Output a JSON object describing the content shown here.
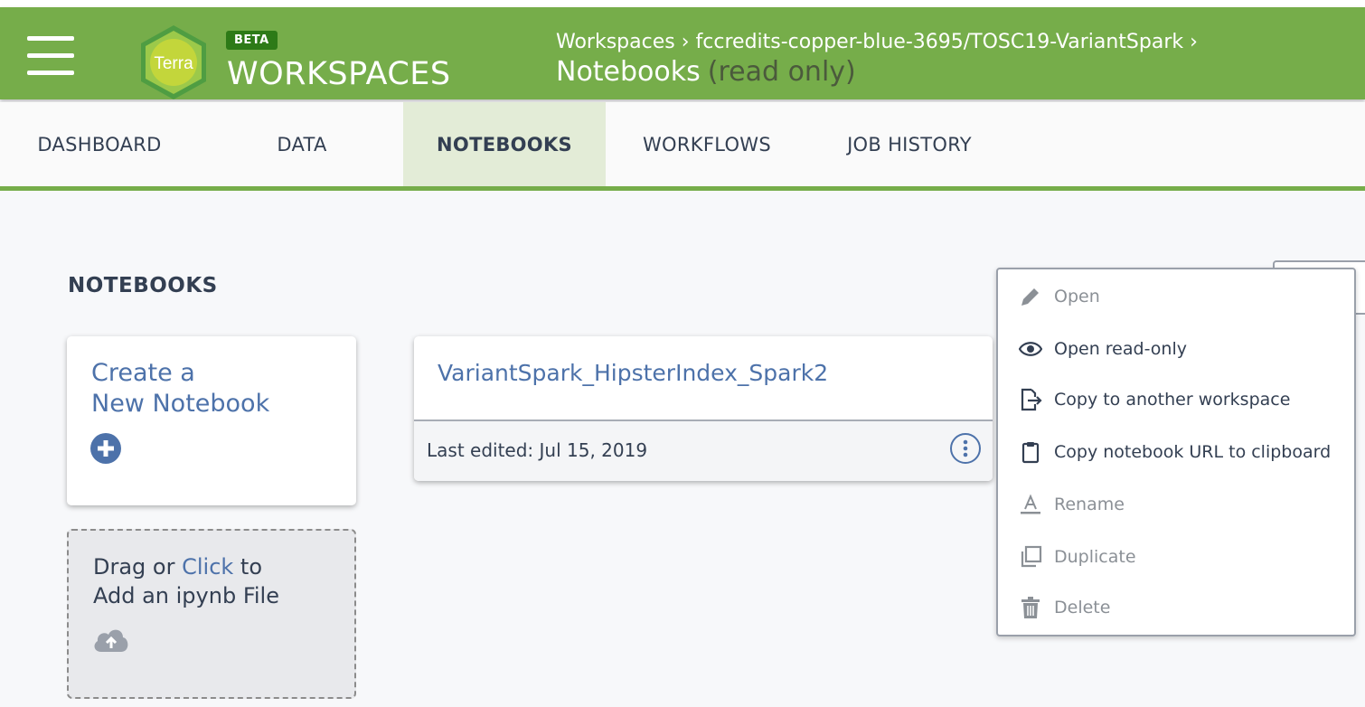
{
  "header": {
    "logo_text": "Terra",
    "badge": "BETA",
    "product": "WORKSPACES",
    "breadcrumb_root": "Workspaces",
    "breadcrumb_separator": "›",
    "breadcrumb_workspace": "fccredits-copper-blue-3695/TOSC19-VariantSpark",
    "title": "Notebooks",
    "title_suffix": "(read only)"
  },
  "tabs": [
    {
      "label": "DASHBOARD",
      "active": false
    },
    {
      "label": "DATA",
      "active": false
    },
    {
      "label": "NOTEBOOKS",
      "active": true
    },
    {
      "label": "WORKFLOWS",
      "active": false
    },
    {
      "label": "JOB HISTORY",
      "active": false
    }
  ],
  "main": {
    "section_title": "NOTEBOOKS",
    "create_line1": "Create a",
    "create_line2": "New Notebook",
    "upload_prefix": "Drag or ",
    "upload_link": "Click",
    "upload_suffix": " to",
    "upload_line2": "Add an ipynb File",
    "notebook": {
      "name": "VariantSpark_HipsterIndex_Spark2",
      "last_edited": "Last edited: Jul 15, 2019"
    }
  },
  "menu": {
    "items": [
      {
        "label": "Open",
        "icon": "pencil-icon",
        "enabled": false
      },
      {
        "label": "Open read-only",
        "icon": "eye-icon",
        "enabled": true
      },
      {
        "label": "Copy to another workspace",
        "icon": "copy-out-icon",
        "enabled": true
      },
      {
        "label": "Copy notebook URL to clipboard",
        "icon": "clipboard-icon",
        "enabled": true
      },
      {
        "label": "Rename",
        "icon": "rename-icon",
        "enabled": false
      },
      {
        "label": "Duplicate",
        "icon": "duplicate-icon",
        "enabled": false
      },
      {
        "label": "Delete",
        "icon": "trash-icon",
        "enabled": false
      }
    ]
  },
  "colors": {
    "header_green": "#76ad4a",
    "link_blue": "#4d72aa",
    "text_dark": "#333f52"
  }
}
